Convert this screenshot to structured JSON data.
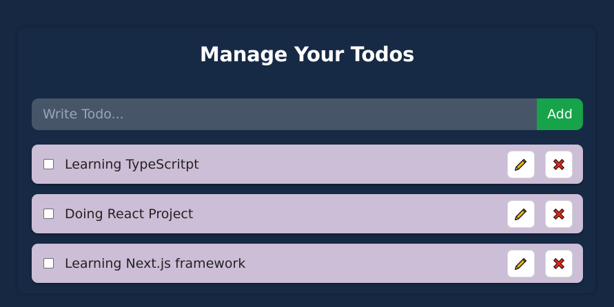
{
  "header": {
    "title": "Manage Your Todos"
  },
  "form": {
    "input_value": "",
    "input_placeholder": "Write Todo...",
    "add_label": "Add"
  },
  "todos": [
    {
      "text": "Learning TypeScritpt",
      "completed": false
    },
    {
      "text": "Doing React Project",
      "completed": false
    },
    {
      "text": "Learning Next.js framework",
      "completed": false
    }
  ],
  "icons": {
    "edit": "pencil-icon",
    "delete": "cross-icon"
  },
  "colors": {
    "background": "#172842",
    "input_bg": "#475569",
    "add_button": "#16a34a",
    "todo_bg": "#ccbed6",
    "delete_icon": "#d92d20",
    "edit_icon": "#f4b400"
  }
}
